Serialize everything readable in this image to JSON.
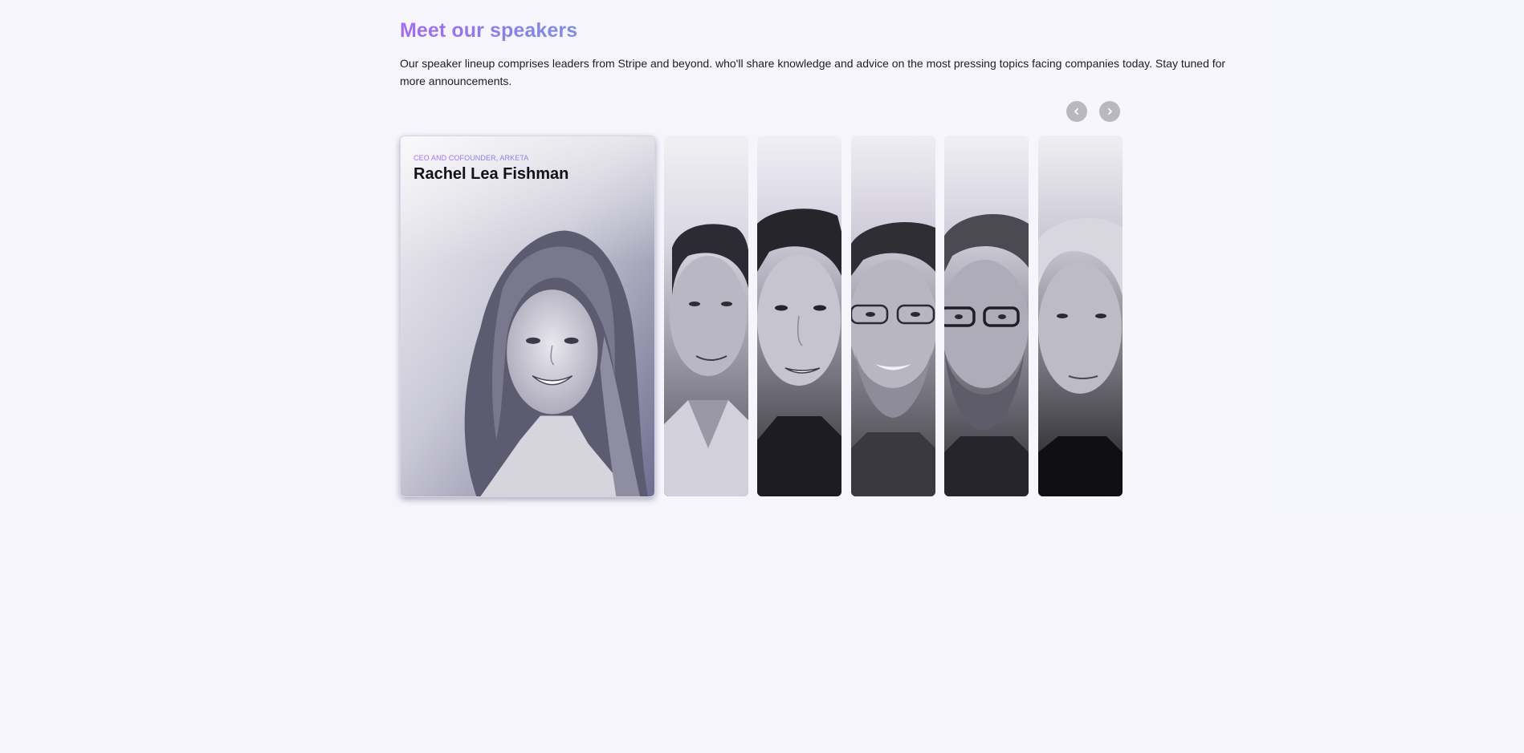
{
  "section": {
    "heading": "Meet our speakers",
    "description": "Our speaker lineup comprises leaders from Stripe and beyond. who'll share knowledge and advice on the most pressing topics facing companies today. Stay tuned for more announcements."
  },
  "navigation": {
    "prev_icon": "chevron-left-icon",
    "next_icon": "chevron-right-icon"
  },
  "featured_speaker": {
    "role": "CEO AND COFOUNDER, ARKETA",
    "name": "Rachel Lea Fishman"
  },
  "colors": {
    "heading_gradient_start": "#a46ce8",
    "heading_gradient_end": "#7b8fe0",
    "page_background": "#f8f6fd",
    "nav_button": "#b9b8c0"
  }
}
